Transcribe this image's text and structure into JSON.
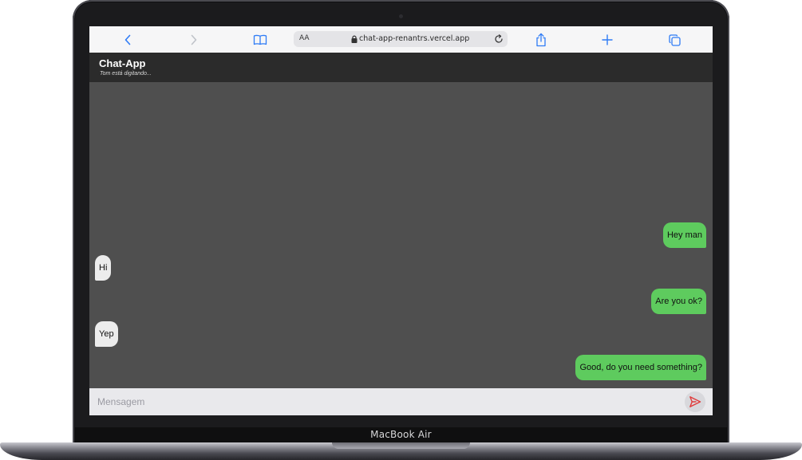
{
  "device": {
    "label": "MacBook Air"
  },
  "browser": {
    "text_size_label": "AA",
    "url": "chat-app-renantrs.vercel.app",
    "icons": {
      "back": "chevron-left-icon",
      "forward": "chevron-right-icon",
      "bookmarks": "book-icon",
      "lock": "lock-icon",
      "reload": "reload-icon",
      "share": "share-icon",
      "new_tab": "plus-icon",
      "tabs": "tabs-icon"
    },
    "accent_color": "#2f7cf6"
  },
  "app": {
    "title": "Chat-App",
    "status": "Tom está digitando..."
  },
  "messages": [
    {
      "text": "Hey man",
      "direction": "sent"
    },
    {
      "text": "Hi",
      "direction": "received"
    },
    {
      "text": "Are you ok?",
      "direction": "sent"
    },
    {
      "text": "Yep",
      "direction": "received"
    },
    {
      "text": "Good, do you need something?",
      "direction": "sent"
    }
  ],
  "composer": {
    "placeholder": "Mensagem",
    "value": "",
    "send_icon": "send-icon",
    "send_icon_color": "#e03b3b"
  },
  "colors": {
    "sent_bubble": "#5ecb5e",
    "received_bubble": "#ececec",
    "chat_background": "#4f4f4f",
    "header_background": "#2b2b2b"
  }
}
